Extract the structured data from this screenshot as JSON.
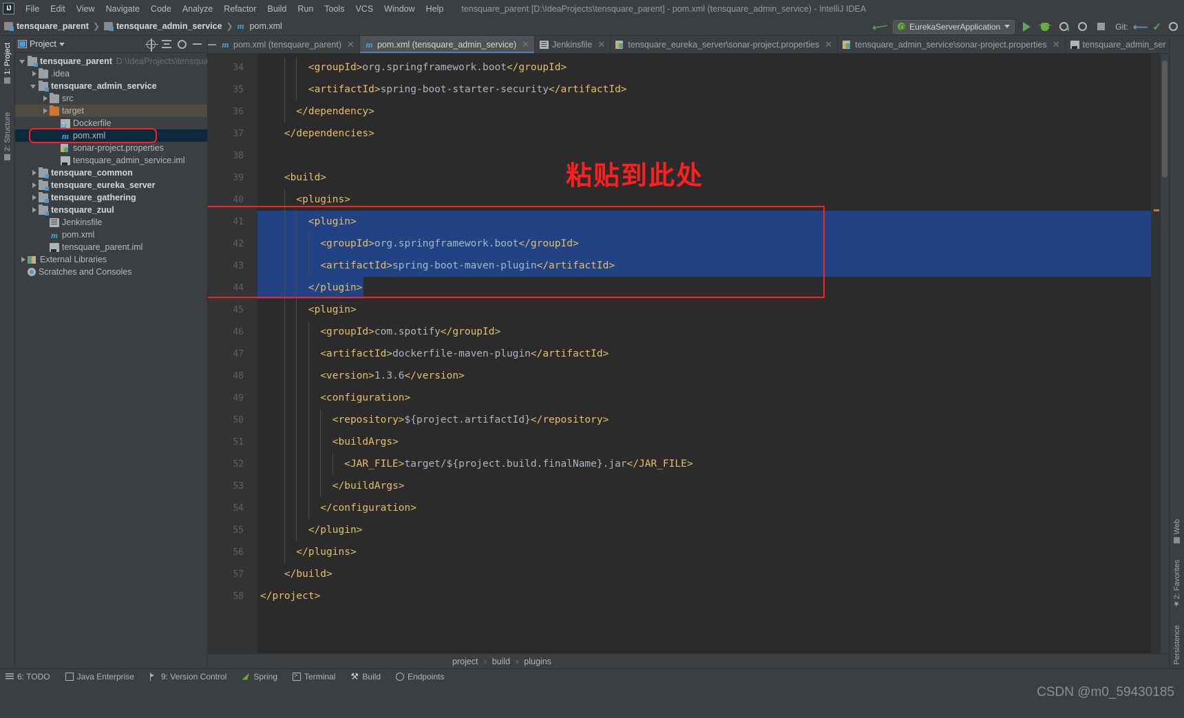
{
  "window": {
    "title": "tensquare_parent [D:\\IdeaProjects\\tensquare_parent] - pom.xml (tensquare_admin_service) - IntelliJ IDEA",
    "logo": "IJ"
  },
  "menu": {
    "items": [
      "File",
      "Edit",
      "View",
      "Navigate",
      "Code",
      "Analyze",
      "Refactor",
      "Build",
      "Run",
      "Tools",
      "VCS",
      "Window",
      "Help"
    ]
  },
  "navbar": {
    "crumbs": [
      "tensquare_parent",
      "tensquare_admin_service",
      "pom.xml"
    ]
  },
  "run_toolbar": {
    "config_name": "EurekaServerApplication",
    "git_label": "Git:",
    "icons": [
      "back-arrow-icon",
      "run-icon",
      "debug-icon",
      "run-with-coverage-icon",
      "profiler-icon",
      "stop-icon",
      "git-update-icon",
      "git-commit-icon",
      "git-history-icon"
    ]
  },
  "project_panel": {
    "title": "Project",
    "actions": [
      "locate-icon",
      "collapse-all-icon",
      "settings-icon",
      "hide-icon"
    ],
    "tree": [
      {
        "label": "tensquare_parent",
        "hint": "D:\\IdeaProjects\\tensqua",
        "indent": 0,
        "arrow": "open",
        "icon": "module",
        "bold": true
      },
      {
        "label": ".idea",
        "hint": "",
        "indent": 1,
        "arrow": "closed",
        "icon": "folder",
        "bold": false
      },
      {
        "label": "tensquare_admin_service",
        "hint": "",
        "indent": 1,
        "arrow": "open",
        "icon": "module",
        "bold": true
      },
      {
        "label": "src",
        "hint": "",
        "indent": 2,
        "arrow": "closed",
        "icon": "folder",
        "bold": false
      },
      {
        "label": "target",
        "hint": "",
        "indent": 2,
        "arrow": "closed",
        "icon": "folder-orange",
        "bold": false,
        "state": "dim-selected"
      },
      {
        "label": "Dockerfile",
        "hint": "",
        "indent": 3,
        "arrow": "none",
        "icon": "docker",
        "bold": false
      },
      {
        "label": "pom.xml",
        "hint": "",
        "indent": 3,
        "arrow": "none",
        "icon": "maven",
        "bold": false,
        "state": "selected"
      },
      {
        "label": "sonar-project.properties",
        "hint": "",
        "indent": 3,
        "arrow": "none",
        "icon": "properties",
        "bold": false
      },
      {
        "label": "tensquare_admin_service.iml",
        "hint": "",
        "indent": 3,
        "arrow": "none",
        "icon": "iml",
        "bold": false
      },
      {
        "label": "tensquare_common",
        "hint": "",
        "indent": 1,
        "arrow": "closed",
        "icon": "module",
        "bold": true
      },
      {
        "label": "tensquare_eureka_server",
        "hint": "",
        "indent": 1,
        "arrow": "closed",
        "icon": "module",
        "bold": true
      },
      {
        "label": "tensquare_gathering",
        "hint": "",
        "indent": 1,
        "arrow": "closed",
        "icon": "module",
        "bold": true
      },
      {
        "label": "tensquare_zuul",
        "hint": "",
        "indent": 1,
        "arrow": "closed",
        "icon": "module",
        "bold": true
      },
      {
        "label": "Jenkinsfile",
        "hint": "",
        "indent": 2,
        "arrow": "none",
        "icon": "jenkins",
        "bold": false
      },
      {
        "label": "pom.xml",
        "hint": "",
        "indent": 2,
        "arrow": "none",
        "icon": "maven",
        "bold": false
      },
      {
        "label": "tensquare_parent.iml",
        "hint": "",
        "indent": 2,
        "arrow": "none",
        "icon": "iml",
        "bold": false
      },
      {
        "label": "External Libraries",
        "hint": "",
        "indent": 0,
        "arrow": "closed",
        "icon": "libraries",
        "bold": false
      },
      {
        "label": "Scratches and Consoles",
        "hint": "",
        "indent": 0,
        "arrow": "none",
        "icon": "scratch",
        "bold": false
      }
    ]
  },
  "left_tool_strip": {
    "tabs": [
      "1: Project",
      "2: Structure"
    ]
  },
  "right_tool_strip": {
    "tabs": [
      "Web",
      "2: Favorites",
      "Persistence"
    ]
  },
  "editor_tabs": [
    {
      "label": "pom.xml (tensquare_parent)",
      "icon": "maven-file-icon",
      "active": false
    },
    {
      "label": "pom.xml (tensquare_admin_service)",
      "icon": "maven-file-icon",
      "active": true
    },
    {
      "label": "Jenkinsfile",
      "icon": "jenkins-file-icon",
      "active": false
    },
    {
      "label": "tensquare_eureka_server\\sonar-project.properties",
      "icon": "properties-file-icon",
      "active": false
    },
    {
      "label": "tensquare_admin_service\\sonar-project.properties",
      "icon": "properties-file-icon",
      "active": false
    },
    {
      "label": "tensquare_admin_ser",
      "icon": "iml-file-icon",
      "active": false
    }
  ],
  "code": {
    "first_line": 34,
    "lines": [
      {
        "n": 34,
        "indent": 8,
        "fold": "none",
        "selected": false,
        "parts": [
          {
            "t": "tag",
            "v": "<groupId>"
          },
          {
            "t": "txt",
            "v": "org.springframework.boot"
          },
          {
            "t": "tag",
            "v": "</groupId>"
          }
        ]
      },
      {
        "n": 35,
        "indent": 8,
        "fold": "none",
        "selected": false,
        "parts": [
          {
            "t": "tag",
            "v": "<artifactId>"
          },
          {
            "t": "txt",
            "v": "spring-boot-starter-security"
          },
          {
            "t": "tag",
            "v": "</artifactId>"
          }
        ]
      },
      {
        "n": 36,
        "indent": 6,
        "fold": "end",
        "selected": false,
        "parts": [
          {
            "t": "tag",
            "v": "</dependency>"
          }
        ]
      },
      {
        "n": 37,
        "indent": 4,
        "fold": "end",
        "selected": false,
        "parts": [
          {
            "t": "tag",
            "v": "</dependencies>"
          }
        ]
      },
      {
        "n": 38,
        "indent": 0,
        "fold": "none",
        "selected": false,
        "parts": []
      },
      {
        "n": 39,
        "indent": 4,
        "fold": "start",
        "selected": false,
        "parts": [
          {
            "t": "tag",
            "v": "<build>"
          }
        ]
      },
      {
        "n": 40,
        "indent": 6,
        "fold": "start",
        "selected": false,
        "parts": [
          {
            "t": "tag",
            "v": "<plugins>"
          }
        ]
      },
      {
        "n": 41,
        "indent": 8,
        "fold": "start",
        "selected": true,
        "bulb": true,
        "parts": [
          {
            "t": "tag",
            "v": "<plugin>"
          }
        ]
      },
      {
        "n": 42,
        "indent": 10,
        "fold": "none",
        "selected": true,
        "parts": [
          {
            "t": "tag",
            "v": "<groupId>"
          },
          {
            "t": "txt",
            "v": "org.springframework.boot"
          },
          {
            "t": "tag",
            "v": "</groupId>"
          }
        ]
      },
      {
        "n": 43,
        "indent": 10,
        "fold": "none",
        "selected": true,
        "runmark": true,
        "parts": [
          {
            "t": "tag",
            "v": "<artifactId>"
          },
          {
            "t": "txt",
            "v": "spring-boot-maven-plugin"
          },
          {
            "t": "tag",
            "v": "</artifactId>"
          }
        ]
      },
      {
        "n": 44,
        "indent": 8,
        "fold": "end",
        "selected": true,
        "partial": true,
        "parts": [
          {
            "t": "tag",
            "v": "</plugin>"
          }
        ]
      },
      {
        "n": 45,
        "indent": 8,
        "fold": "start",
        "selected": false,
        "parts": [
          {
            "t": "tag",
            "v": "<plugin>"
          }
        ]
      },
      {
        "n": 46,
        "indent": 10,
        "fold": "none",
        "selected": false,
        "parts": [
          {
            "t": "tag",
            "v": "<groupId>"
          },
          {
            "t": "txt",
            "v": "com.spotify"
          },
          {
            "t": "tag",
            "v": "</groupId>"
          }
        ]
      },
      {
        "n": 47,
        "indent": 10,
        "fold": "none",
        "selected": false,
        "parts": [
          {
            "t": "tag",
            "v": "<artifactId>"
          },
          {
            "t": "txt",
            "v": "dockerfile-maven-plugin"
          },
          {
            "t": "tag",
            "v": "</artifactId>"
          }
        ]
      },
      {
        "n": 48,
        "indent": 10,
        "fold": "none",
        "selected": false,
        "parts": [
          {
            "t": "tag",
            "v": "<version>"
          },
          {
            "t": "txt",
            "v": "1.3.6"
          },
          {
            "t": "tag",
            "v": "</version>"
          }
        ]
      },
      {
        "n": 49,
        "indent": 10,
        "fold": "start",
        "selected": false,
        "parts": [
          {
            "t": "tag",
            "v": "<configuration>"
          }
        ]
      },
      {
        "n": 50,
        "indent": 12,
        "fold": "none",
        "selected": false,
        "parts": [
          {
            "t": "tag",
            "v": "<repository>"
          },
          {
            "t": "txt",
            "v": "${project.artifactId}"
          },
          {
            "t": "tag",
            "v": "</repository>"
          }
        ]
      },
      {
        "n": 51,
        "indent": 12,
        "fold": "start",
        "selected": false,
        "parts": [
          {
            "t": "tag",
            "v": "<buildArgs>"
          }
        ]
      },
      {
        "n": 52,
        "indent": 14,
        "fold": "none",
        "selected": false,
        "parts": [
          {
            "t": "tag",
            "v": "<JAR_FILE>"
          },
          {
            "t": "txt",
            "v": "target/${project.build.finalName}.jar"
          },
          {
            "t": "tag",
            "v": "</JAR_FILE>"
          }
        ]
      },
      {
        "n": 53,
        "indent": 12,
        "fold": "end",
        "selected": false,
        "parts": [
          {
            "t": "tag",
            "v": "</buildArgs>"
          }
        ]
      },
      {
        "n": 54,
        "indent": 10,
        "fold": "end",
        "selected": false,
        "parts": [
          {
            "t": "tag",
            "v": "</configuration>"
          }
        ]
      },
      {
        "n": 55,
        "indent": 8,
        "fold": "end",
        "selected": false,
        "parts": [
          {
            "t": "tag",
            "v": "</plugin>"
          }
        ]
      },
      {
        "n": 56,
        "indent": 6,
        "fold": "end",
        "selected": false,
        "parts": [
          {
            "t": "tag",
            "v": "</plugins>"
          }
        ]
      },
      {
        "n": 57,
        "indent": 4,
        "fold": "end",
        "selected": false,
        "parts": [
          {
            "t": "tag",
            "v": "</build>"
          }
        ]
      },
      {
        "n": 58,
        "indent": 0,
        "fold": "end",
        "selected": false,
        "parts": [
          {
            "t": "tag",
            "v": "</project>"
          }
        ]
      }
    ]
  },
  "annotation": {
    "note_text": "粘贴到此处",
    "note_color": "#ff1f1f",
    "box_color": "#ff2020"
  },
  "editor_breadcrumb": {
    "items": [
      "project",
      "build",
      "plugins"
    ],
    "separator": "›"
  },
  "bottom_bar": {
    "items": [
      {
        "label": "6: TODO",
        "icon": "todo-icon"
      },
      {
        "label": "Java Enterprise",
        "icon": "java-enterprise-icon"
      },
      {
        "label": "9: Version Control",
        "icon": "version-control-icon"
      },
      {
        "label": "Spring",
        "icon": "spring-icon"
      },
      {
        "label": "Terminal",
        "icon": "terminal-icon"
      },
      {
        "label": "Build",
        "icon": "build-icon"
      },
      {
        "label": "Endpoints",
        "icon": "endpoints-icon"
      }
    ]
  },
  "watermark": {
    "text": "CSDN @m0_59430185"
  }
}
